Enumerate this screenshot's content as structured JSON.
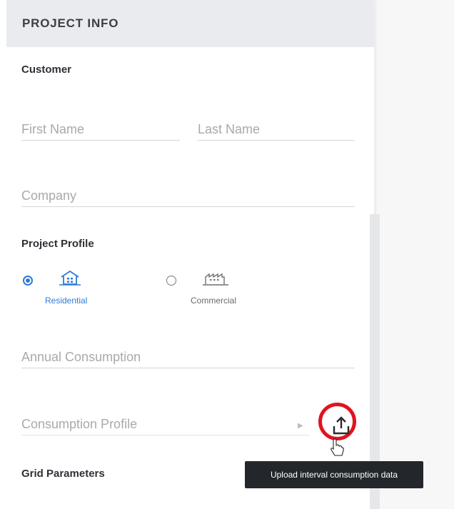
{
  "header": {
    "title": "PROJECT INFO"
  },
  "customer": {
    "section_label": "Customer",
    "first_name_placeholder": "First Name",
    "last_name_placeholder": "Last Name",
    "company_placeholder": "Company"
  },
  "profile": {
    "section_label": "Project Profile",
    "options": [
      {
        "label": "Residential",
        "icon": "house-icon",
        "selected": true
      },
      {
        "label": "Commercial",
        "icon": "factory-icon",
        "selected": false
      }
    ],
    "annual_consumption_placeholder": "Annual Consumption",
    "consumption_profile_placeholder": "Consumption Profile"
  },
  "grid": {
    "section_label": "Grid Parameters"
  },
  "upload": {
    "icon": "upload-icon",
    "tooltip": "Upload interval consumption data"
  },
  "colors": {
    "accent": "#2e7bd6",
    "highlight_ring": "#e0141e",
    "header_bg": "#e9ebef",
    "tooltip_bg": "#23262b"
  }
}
